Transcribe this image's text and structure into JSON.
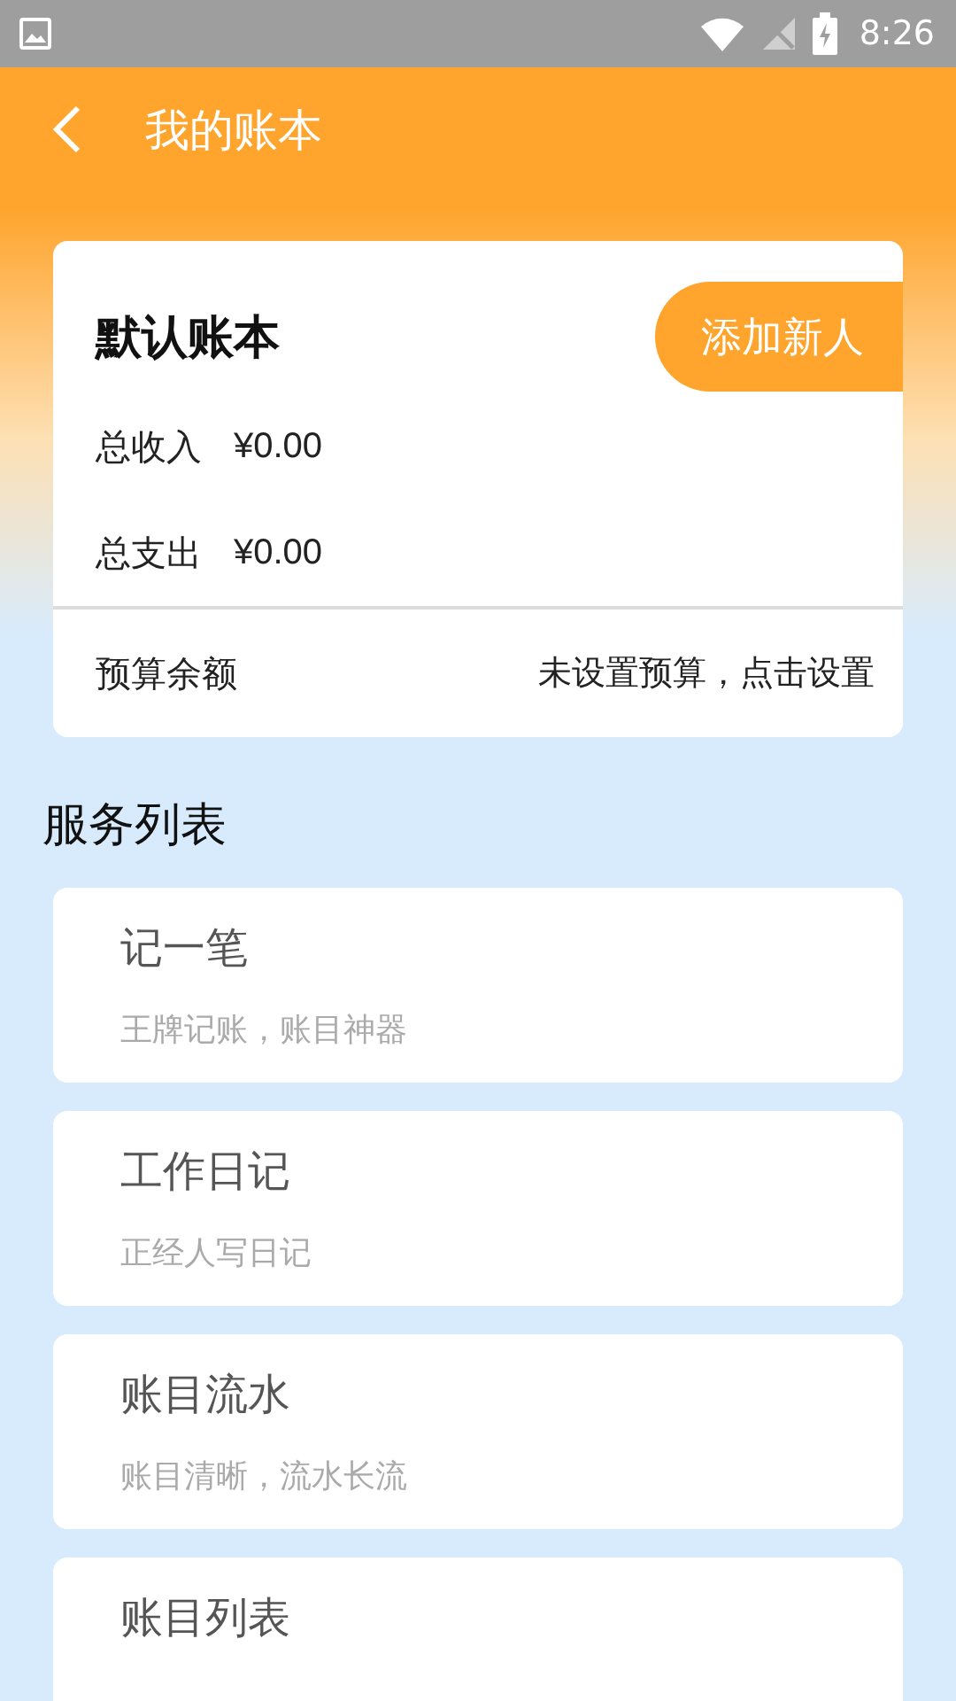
{
  "status_bar": {
    "time": "8:26"
  },
  "header": {
    "title": "我的账本"
  },
  "ledger": {
    "name": "默认账本",
    "add_button": "添加新人",
    "income_label": "总收入",
    "income": "¥0.00",
    "expense_label": "总支出",
    "expense": "¥0.00",
    "budget_label": "预算余额",
    "budget_action": "未设置预算，点击设置"
  },
  "services": {
    "title": "服务列表",
    "items": [
      {
        "title": "记一笔",
        "subtitle": "王牌记账，账目神器"
      },
      {
        "title": "工作日记",
        "subtitle": "正经人写日记"
      },
      {
        "title": "账目流水",
        "subtitle": "账目清晰，流水长流"
      },
      {
        "title": "账目列表"
      }
    ]
  }
}
